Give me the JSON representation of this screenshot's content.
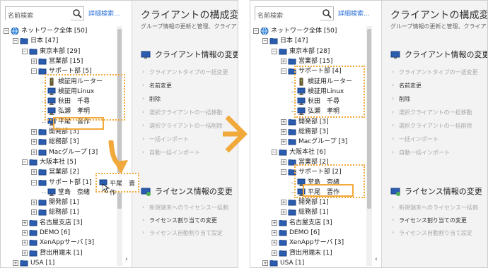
{
  "search": {
    "placeholder": "名前検索",
    "advanced_link": "詳細検索..."
  },
  "title": "クライアントの構成変更",
  "subtitle": "グループ情報の更新と管理、クライアン",
  "sections": {
    "client_info": {
      "heading": "クライアント情報の変更",
      "actions": [
        {
          "label": "クライアントタイプの一括変更",
          "enabled": false
        },
        {
          "label": "名前変更",
          "enabled": true
        },
        {
          "label": "削除",
          "enabled": true
        },
        {
          "label": "選択クライアントの一括移動",
          "enabled": false
        },
        {
          "label": "選択クライアントの一括削除",
          "enabled": false
        },
        {
          "label": "一括インポート",
          "enabled": false
        },
        {
          "label": "自動一括インポート",
          "enabled": false
        }
      ]
    },
    "license_info": {
      "heading": "ライセンス情報の変更",
      "actions_before": [
        {
          "label": "新規端末へのライセンス一括割",
          "enabled": false
        },
        {
          "label": "ライセンス割り当ての変更",
          "enabled": true
        },
        {
          "label": "ライセンス自動割り当て設定",
          "enabled": false
        }
      ],
      "actions_after": [
        {
          "label": "新規端末へのライセンス一括割",
          "enabled": false
        },
        {
          "label": "ライセンス割り当ての変更",
          "enabled": true
        },
        {
          "label": "ライセンス自動割り当て設定",
          "enabled": false
        }
      ]
    }
  },
  "tree_before": [
    {
      "label": "ネットワーク全体 [50]",
      "icon": "globe-icon",
      "level": 0,
      "exp": "−"
    },
    {
      "label": "日本 [47]",
      "icon": "folder-icon",
      "level": 1,
      "exp": "−"
    },
    {
      "label": "東京本部 [29]",
      "icon": "folder-icon",
      "level": 2,
      "exp": "−"
    },
    {
      "label": "営業部 [15]",
      "icon": "folder-icon",
      "level": 3,
      "exp": "+"
    },
    {
      "label": "サポート部 [5]",
      "icon": "folder-icon",
      "level": 3,
      "exp": "−"
    },
    {
      "label": "検証用ルーター",
      "icon": "router-icon",
      "level": 4,
      "exp": ""
    },
    {
      "label": "検証用Linux",
      "icon": "computer-icon",
      "level": 4,
      "exp": ""
    },
    {
      "label": "秋田　千尋",
      "icon": "computer-icon",
      "level": 4,
      "exp": ""
    },
    {
      "label": "弘瀬　孝明",
      "icon": "computer-icon",
      "level": 4,
      "exp": ""
    },
    {
      "label": "平尾　晋作",
      "icon": "computer-icon",
      "level": 4,
      "exp": ""
    },
    {
      "label": "開発部 [3]",
      "icon": "folder-icon",
      "level": 3,
      "exp": "+"
    },
    {
      "label": "総務部 [3]",
      "icon": "folder-icon",
      "level": 3,
      "exp": "+"
    },
    {
      "label": "Macグループ [3]",
      "icon": "folder-icon",
      "level": 3,
      "exp": "+"
    },
    {
      "label": "大阪本社 [5]",
      "icon": "folder-icon",
      "level": 2,
      "exp": "−"
    },
    {
      "label": "営業部 [2]",
      "icon": "folder-icon",
      "level": 3,
      "exp": "+"
    },
    {
      "label": "サポート部 [1]",
      "icon": "folder-icon",
      "level": 3,
      "exp": "−"
    },
    {
      "label": "堂島　奈緒",
      "icon": "computer-icon",
      "level": 4,
      "exp": ""
    },
    {
      "label": "開発部 [1]",
      "icon": "folder-icon",
      "level": 3,
      "exp": "+"
    },
    {
      "label": "総務部 [1]",
      "icon": "folder-icon",
      "level": 3,
      "exp": "+"
    },
    {
      "label": "名古屋支店 [3]",
      "icon": "folder-icon",
      "level": 2,
      "exp": "+"
    },
    {
      "label": "DEMO [6]",
      "icon": "folder-icon",
      "level": 2,
      "exp": "+"
    },
    {
      "label": "XenAppサーバ [3]",
      "icon": "folder-icon",
      "level": 2,
      "exp": "+"
    },
    {
      "label": "貸出用端末 [1]",
      "icon": "folder-icon",
      "level": 2,
      "exp": "+"
    },
    {
      "label": "USA [1]",
      "icon": "folder-icon",
      "level": 1,
      "exp": "+"
    }
  ],
  "tree_after": [
    {
      "label": "ネットワーク全体 [50]",
      "icon": "globe-icon",
      "level": 0,
      "exp": "−"
    },
    {
      "label": "日本 [47]",
      "icon": "folder-icon",
      "level": 1,
      "exp": "−"
    },
    {
      "label": "東京本部 [28]",
      "icon": "folder-icon",
      "level": 2,
      "exp": "−"
    },
    {
      "label": "営業部 [15]",
      "icon": "folder-icon",
      "level": 3,
      "exp": "+"
    },
    {
      "label": "サポート部 [4]",
      "icon": "folder-icon",
      "level": 3,
      "exp": "−"
    },
    {
      "label": "検証用ルーター",
      "icon": "router-icon",
      "level": 4,
      "exp": ""
    },
    {
      "label": "検証用Linux",
      "icon": "computer-icon",
      "level": 4,
      "exp": ""
    },
    {
      "label": "秋田　千尋",
      "icon": "computer-icon",
      "level": 4,
      "exp": ""
    },
    {
      "label": "弘瀬　孝明",
      "icon": "computer-icon",
      "level": 4,
      "exp": ""
    },
    {
      "label": "開発部 [3]",
      "icon": "folder-icon",
      "level": 3,
      "exp": "+"
    },
    {
      "label": "総務部 [3]",
      "icon": "folder-icon",
      "level": 3,
      "exp": "+"
    },
    {
      "label": "Macグループ [3]",
      "icon": "folder-icon",
      "level": 3,
      "exp": "+"
    },
    {
      "label": "大阪本社 [6]",
      "icon": "folder-icon",
      "level": 2,
      "exp": "−"
    },
    {
      "label": "営業部 [2]",
      "icon": "folder-icon",
      "level": 3,
      "exp": "+"
    },
    {
      "label": "サポート部 [2]",
      "icon": "folder-icon",
      "level": 3,
      "exp": "−"
    },
    {
      "label": "堂島　奈緒",
      "icon": "computer-icon",
      "level": 4,
      "exp": ""
    },
    {
      "label": "平尾　晋作",
      "icon": "computer-icon",
      "level": 4,
      "exp": ""
    },
    {
      "label": "開発部 [1]",
      "icon": "folder-icon",
      "level": 3,
      "exp": "+"
    },
    {
      "label": "総務部 [1]",
      "icon": "folder-icon",
      "level": 3,
      "exp": "+"
    },
    {
      "label": "名古屋支店 [3]",
      "icon": "folder-icon",
      "level": 2,
      "exp": "+"
    },
    {
      "label": "DEMO [6]",
      "icon": "folder-icon",
      "level": 2,
      "exp": "+"
    },
    {
      "label": "XenAppサーバ [3]",
      "icon": "folder-icon",
      "level": 2,
      "exp": "+"
    },
    {
      "label": "貸出用端末 [1]",
      "icon": "folder-icon",
      "level": 2,
      "exp": "+"
    },
    {
      "label": "USA [1]",
      "icon": "folder-icon",
      "level": 1,
      "exp": "+"
    }
  ],
  "drag_ghost": {
    "label": "平尾　晋作"
  },
  "colors": {
    "highlight": "#f2a93b",
    "link": "#2a6fd6",
    "folder": "#d9b24a",
    "computer": "#2a5db0"
  }
}
